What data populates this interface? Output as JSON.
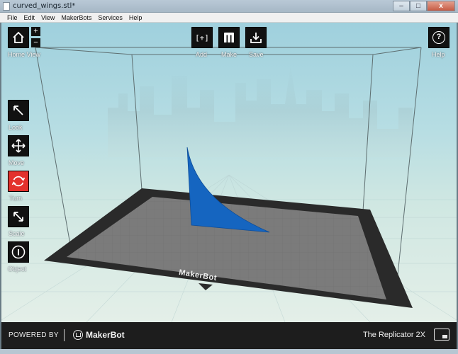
{
  "window": {
    "title": "curved_wings.stl*",
    "controls": {
      "minimize": "–",
      "maximize": "□",
      "close": "x"
    }
  },
  "menu": [
    "File",
    "Edit",
    "View",
    "MakerBots",
    "Services",
    "Help"
  ],
  "toolbar": {
    "home_label": "Home View",
    "zoom_in": "+",
    "zoom_out": "−",
    "add_label": "Add",
    "make_label": "Make",
    "save_label": "Save",
    "help_label": "Help",
    "add_glyph": "[+]",
    "help_glyph": "?"
  },
  "tools": {
    "look_label": "Look",
    "move_label": "Move",
    "turn_label": "Turn",
    "scale_label": "Scale",
    "object_label": "Object",
    "active": "turn"
  },
  "plate": {
    "brand": "MakerBot"
  },
  "footer": {
    "powered_by": "POWERED BY",
    "brand": "MakerBot",
    "printer": "The Replicator 2X"
  },
  "colors": {
    "model": "#1565c0",
    "active_tool": "#e3312c",
    "button": "#111111",
    "footer": "#1d1d1d"
  }
}
